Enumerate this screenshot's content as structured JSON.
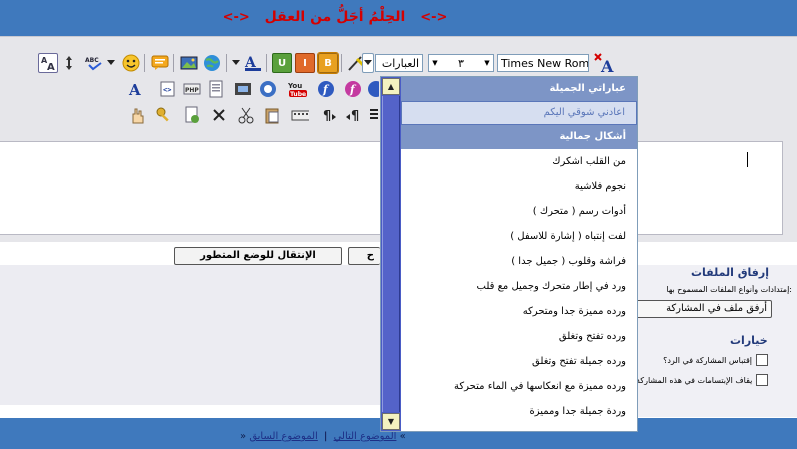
{
  "header": {
    "deco_left": "<->",
    "title": "الحِلْمُ أجَلُّ من العقل",
    "deco_right": "<->"
  },
  "toolbar": {
    "font_name": "Times New Roman",
    "font_size": "٣",
    "smilies_select": "العبارات",
    "colors": {
      "accent": "#3f79bd",
      "title_red": "#d40000"
    }
  },
  "dropdown": {
    "items": [
      {
        "label": "عباراتي الجميلة",
        "kind": "group"
      },
      {
        "label": "اعادني شوقي اليكم",
        "kind": "highlighted"
      },
      {
        "label": "أشكال جمالية",
        "kind": "group"
      },
      {
        "label": "من القلب اشكرك",
        "kind": "item"
      },
      {
        "label": "نجوم فلاشية",
        "kind": "item"
      },
      {
        "label": "أدوات رسم ( متحرك )",
        "kind": "item"
      },
      {
        "label": "لفت إنتباه ( إشارة للاسفل )",
        "kind": "item"
      },
      {
        "label": "فراشة وقلوب ( جميل جدا )",
        "kind": "item"
      },
      {
        "label": "ورد في إطار متحرك وجميل مع قلب",
        "kind": "item"
      },
      {
        "label": "ورده مميزة جدا ومتحركه",
        "kind": "item"
      },
      {
        "label": "ورده تفتح وتغلق",
        "kind": "item"
      },
      {
        "label": "ورده جميلة تفتح وتغلق",
        "kind": "item"
      },
      {
        "label": "ورده مميزة مع انعكاسها في الماء متحركة",
        "kind": "item"
      },
      {
        "label": "وردة جميلة جدا ومميزة",
        "kind": "item"
      }
    ]
  },
  "mode_buttons": {
    "switch_label": "الإنتقال للوضع المتطور",
    "partial_label": "ح"
  },
  "attachments": {
    "legend": "إرفاق الملفات",
    "note": "إمتدادات وأنواع الملفات المسموح بها:",
    "button_label": "أرفق ملف في المشاركة"
  },
  "options": {
    "legend": "خيارات",
    "quote_label": "إقتباس المشاركة في الرد؟",
    "disable_smilies_label": "إيقاف الإبتسامات في هذه المشاركة"
  },
  "footer": {
    "prev_arrow": "«",
    "prev_label": "الموضوع السابق",
    "separator": "|",
    "next_label": "الموضوع التالي",
    "next_arrow": "»"
  }
}
